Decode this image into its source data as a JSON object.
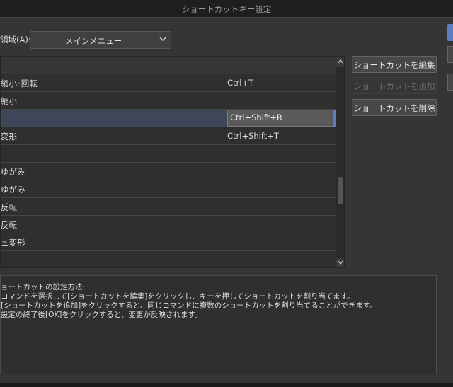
{
  "window": {
    "title": "ショートカットキー設定"
  },
  "area": {
    "label": "領域(A):",
    "selected": "メインメニュー"
  },
  "list": {
    "rows": [
      {
        "name": "",
        "key": ""
      },
      {
        "name": "縮小･回転",
        "key": "Ctrl+T"
      },
      {
        "name": "縮小",
        "key": ""
      },
      {
        "name": "",
        "key": "Ctrl+Shift+R",
        "selected": true
      },
      {
        "name": "変形",
        "key": "Ctrl+Shift+T"
      },
      {
        "name": "",
        "key": ""
      },
      {
        "name": "ゆがみ",
        "key": ""
      },
      {
        "name": "ゆがみ",
        "key": ""
      },
      {
        "name": "反転",
        "key": ""
      },
      {
        "name": "反転",
        "key": ""
      },
      {
        "name": "ュ変形",
        "key": ""
      }
    ]
  },
  "buttons": {
    "edit": "ショートカットを編集",
    "add": "ショートカットを追加",
    "delete": "ショートカットを削除"
  },
  "help": {
    "lines": [
      "ョートカットの設定方法:",
      "コマンドを選択して[ショートカットを編集]をクリックし、キーを押してショートカットを割り当てます。",
      "[ショートカットを追加]をクリックすると、同じコマンドに複数のショートカットを割り当てることができます。",
      "設定の終了後[OK]をクリックすると、変更が反映されます。"
    ]
  },
  "colors": {
    "accent": "#5b7fc2",
    "selected_row": "#3e4658"
  }
}
